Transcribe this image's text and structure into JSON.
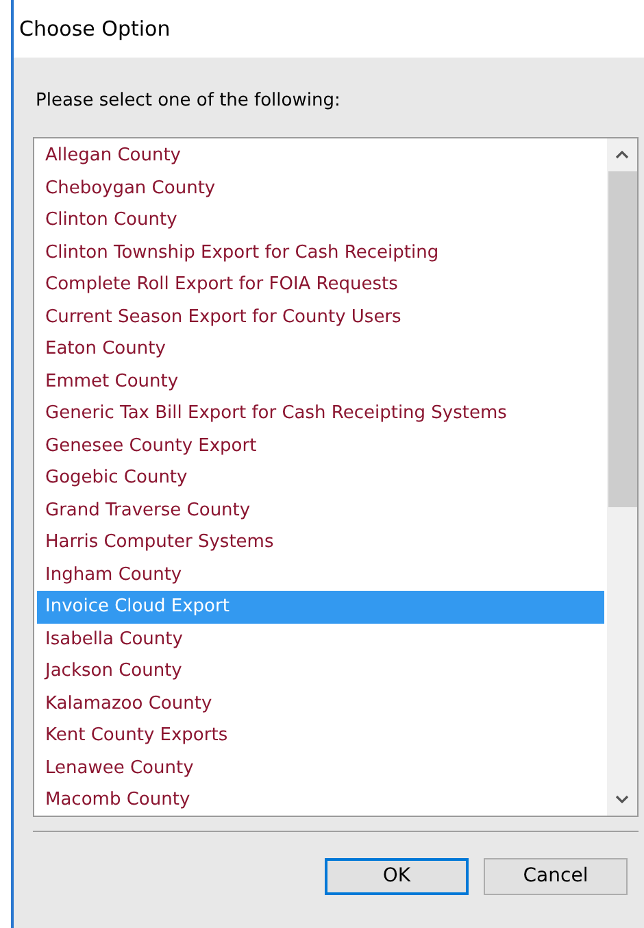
{
  "window": {
    "title": "Choose Option"
  },
  "prompt": "Please select one of the following:",
  "options": [
    {
      "label": "Allegan County",
      "selected": false
    },
    {
      "label": "Cheboygan County",
      "selected": false
    },
    {
      "label": "Clinton County",
      "selected": false
    },
    {
      "label": "Clinton Township Export for Cash Receipting",
      "selected": false
    },
    {
      "label": "Complete Roll Export for FOIA Requests",
      "selected": false
    },
    {
      "label": "Current Season Export for County Users",
      "selected": false
    },
    {
      "label": "Eaton County",
      "selected": false
    },
    {
      "label": "Emmet County",
      "selected": false
    },
    {
      "label": "Generic Tax Bill Export for Cash Receipting Systems",
      "selected": false
    },
    {
      "label": "Genesee County Export",
      "selected": false
    },
    {
      "label": "Gogebic County",
      "selected": false
    },
    {
      "label": "Grand Traverse County",
      "selected": false
    },
    {
      "label": "Harris Computer Systems",
      "selected": false
    },
    {
      "label": "Ingham County",
      "selected": false
    },
    {
      "label": "Invoice Cloud Export",
      "selected": true
    },
    {
      "label": "Isabella County",
      "selected": false
    },
    {
      "label": "Jackson County",
      "selected": false
    },
    {
      "label": "Kalamazoo County",
      "selected": false
    },
    {
      "label": "Kent County Exports",
      "selected": false
    },
    {
      "label": "Lenawee County",
      "selected": false
    },
    {
      "label": "Macomb County",
      "selected": false
    }
  ],
  "buttons": [
    {
      "label": "OK",
      "kind": "default"
    },
    {
      "label": "Cancel",
      "kind": "normal"
    }
  ]
}
